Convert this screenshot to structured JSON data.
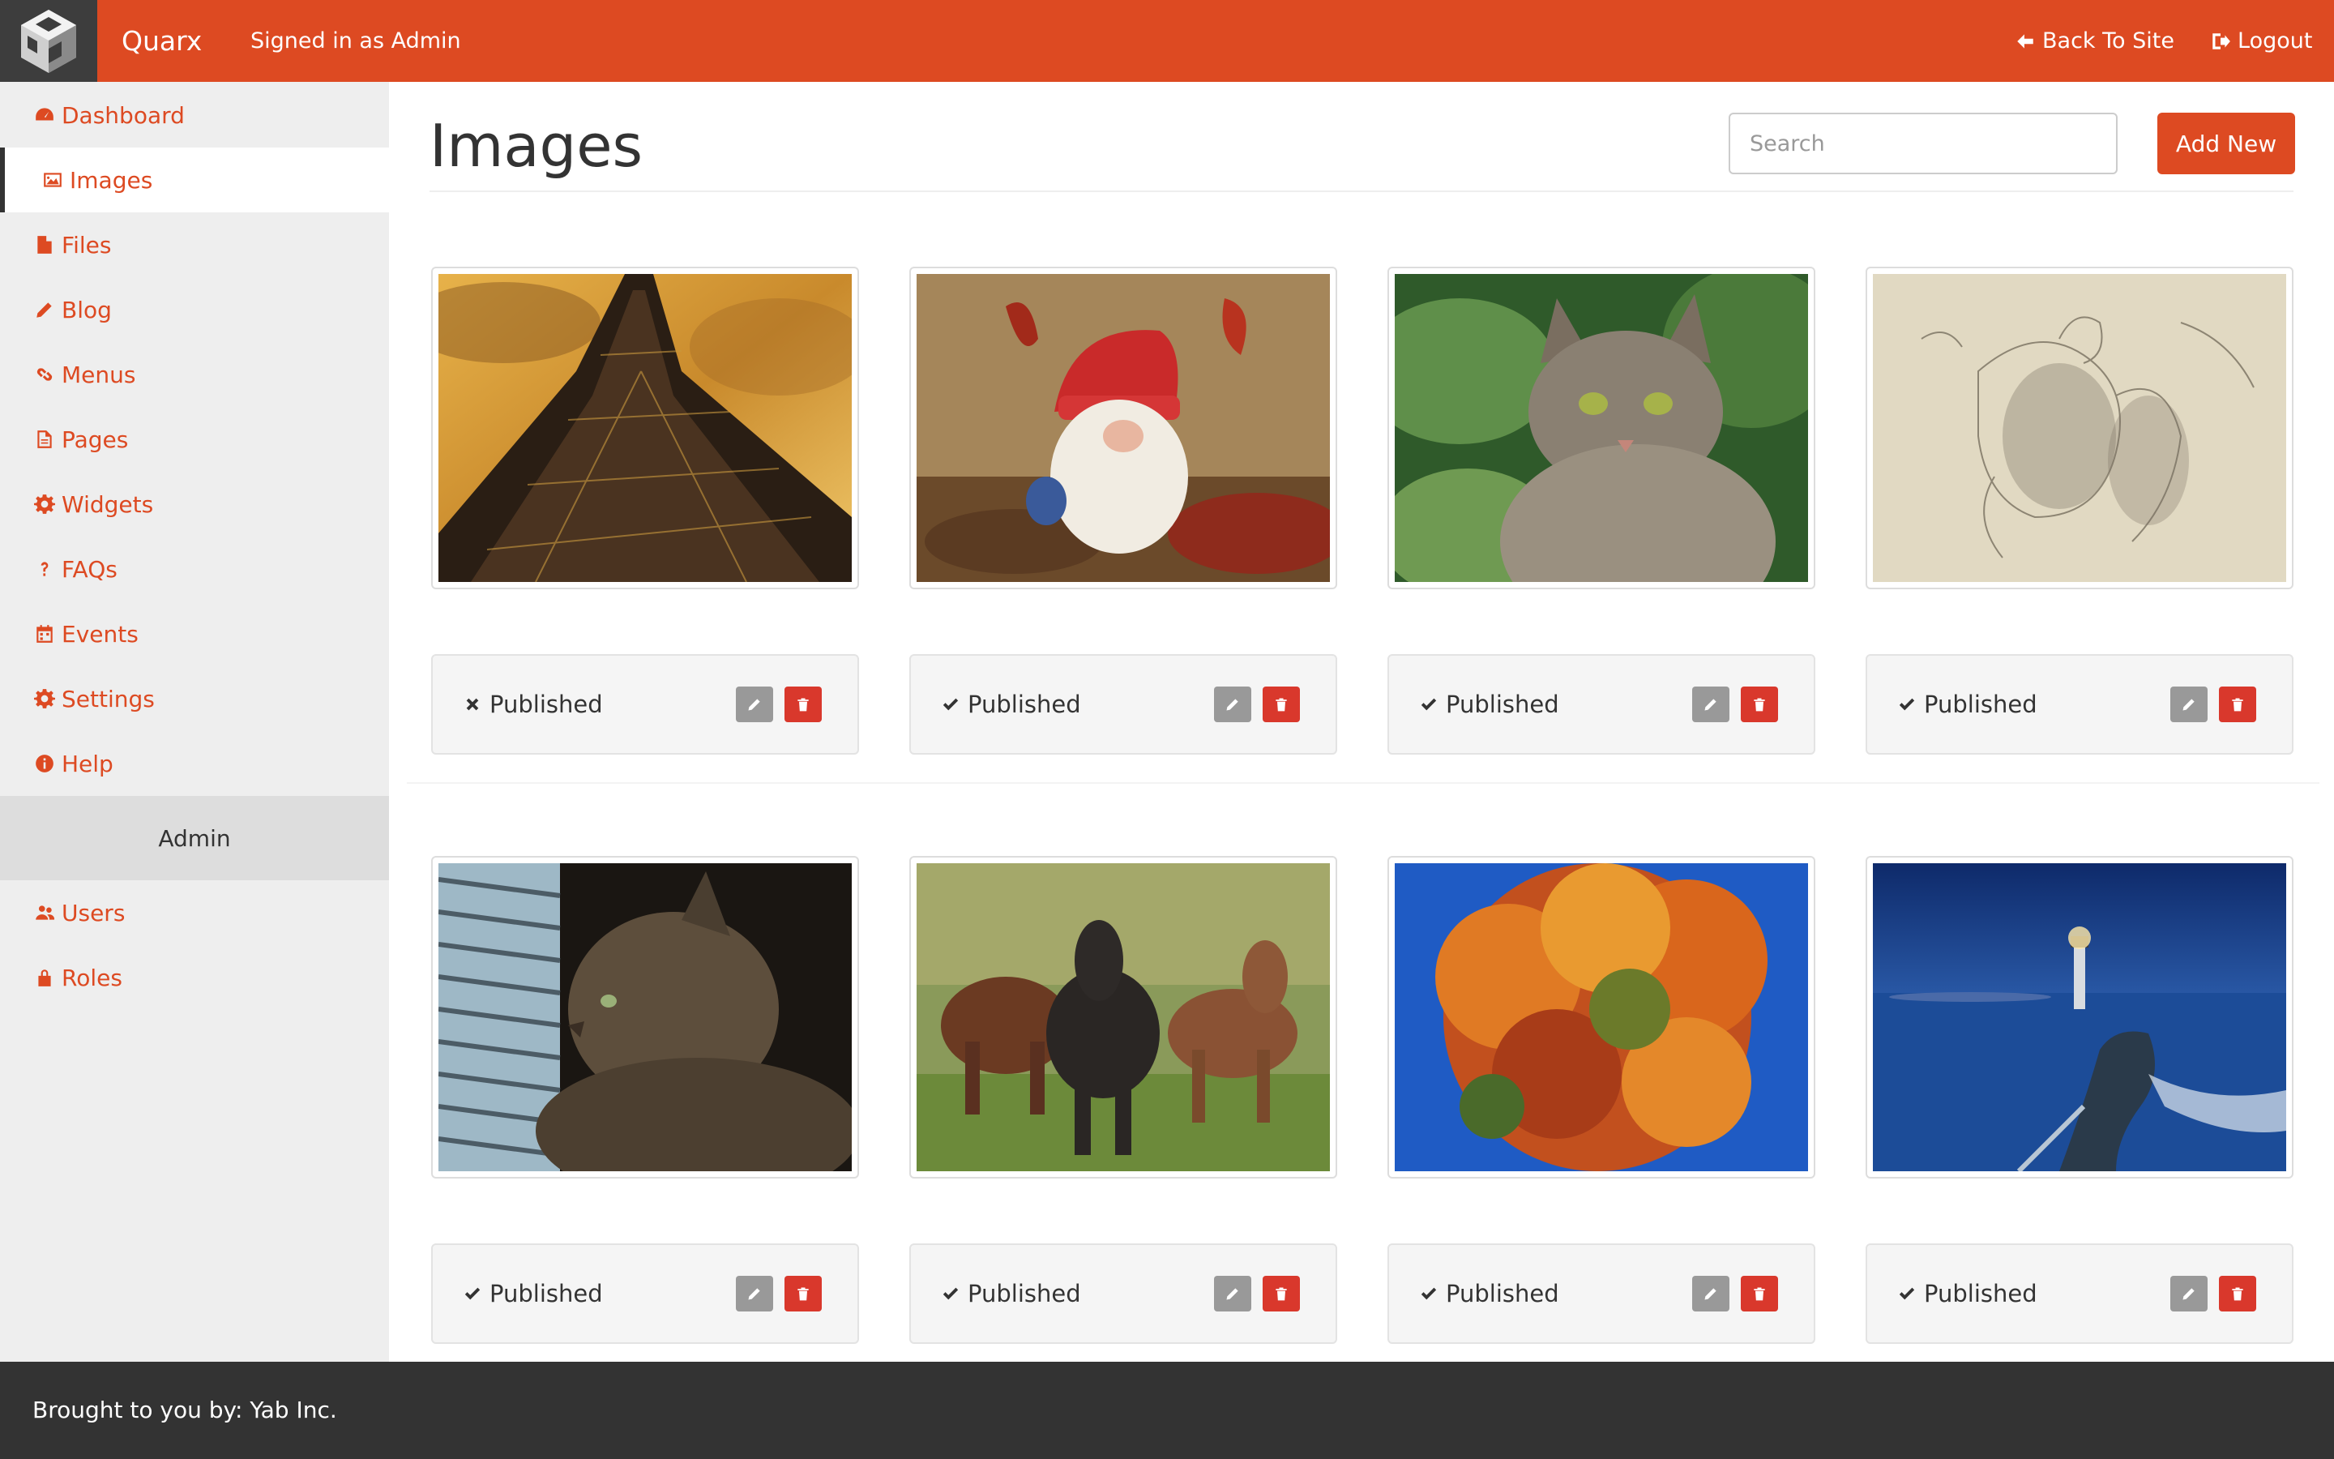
{
  "topbar": {
    "brand": "Quarx",
    "signed_in": "Signed in as Admin",
    "back_to_site": "Back To Site",
    "logout": "Logout",
    "color": "#dd4a22"
  },
  "sidebar": {
    "items": [
      {
        "label": "Dashboard",
        "icon": "dashboard-icon"
      },
      {
        "label": "Images",
        "icon": "image-icon",
        "active": true
      },
      {
        "label": "Files",
        "icon": "file-icon"
      },
      {
        "label": "Blog",
        "icon": "pencil-icon"
      },
      {
        "label": "Menus",
        "icon": "link-icon"
      },
      {
        "label": "Pages",
        "icon": "page-icon"
      },
      {
        "label": "Widgets",
        "icon": "gear-icon"
      },
      {
        "label": "FAQs",
        "icon": "question-icon"
      },
      {
        "label": "Events",
        "icon": "calendar-icon"
      },
      {
        "label": "Settings",
        "icon": "gear-icon"
      },
      {
        "label": "Help",
        "icon": "info-icon"
      }
    ],
    "section_label": "Admin",
    "admin_items": [
      {
        "label": "Users",
        "icon": "users-icon"
      },
      {
        "label": "Roles",
        "icon": "lock-icon"
      }
    ]
  },
  "main": {
    "title": "Images",
    "search_placeholder": "Search",
    "add_new": "Add New",
    "images": [
      {
        "subject": "eiffel-tower",
        "status": "Published",
        "published": false
      },
      {
        "subject": "gnome-plush",
        "status": "Published",
        "published": true
      },
      {
        "subject": "tabby-cat",
        "status": "Published",
        "published": true
      },
      {
        "subject": "sketch-drawing",
        "status": "Published",
        "published": true
      },
      {
        "subject": "cat-at-window",
        "status": "Published",
        "published": true
      },
      {
        "subject": "ponies",
        "status": "Published",
        "published": true
      },
      {
        "subject": "autumn-tree",
        "status": "Published",
        "published": true
      },
      {
        "subject": "lighthouse",
        "status": "Published",
        "published": true
      }
    ]
  },
  "footer": {
    "text": "Brought to you by: Yab Inc."
  }
}
